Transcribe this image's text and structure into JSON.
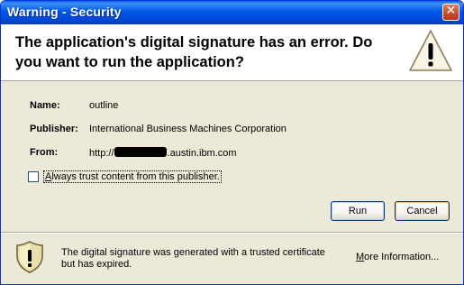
{
  "window": {
    "title": "Warning - Security"
  },
  "header": {
    "message": "The application's digital signature has an error.  Do you want to run the application?",
    "icon": "warning-triangle-icon"
  },
  "details": {
    "name_label": "Name:",
    "name_value": "outline",
    "publisher_label": "Publisher:",
    "publisher_value": "International Business Machines Corporation",
    "from_label": "From:",
    "from_prefix": "http://",
    "from_suffix": ".austin.ibm.com"
  },
  "trust_checkbox": {
    "checked": false,
    "label_first_char": "A",
    "label_rest": "lways trust content from this publisher."
  },
  "buttons": {
    "run_label": "Run",
    "cancel_label": "Cancel"
  },
  "footer": {
    "icon": "shield-warning-icon",
    "message": "The digital signature was generated with a trusted certificate but has expired.",
    "link_first_char": "M",
    "link_rest": "ore Information..."
  },
  "colors": {
    "titlebar": "#0058e6",
    "dialog_bg": "#ece9d8",
    "header_bg": "#ffffff",
    "warning_yellow": "#f5d142"
  }
}
